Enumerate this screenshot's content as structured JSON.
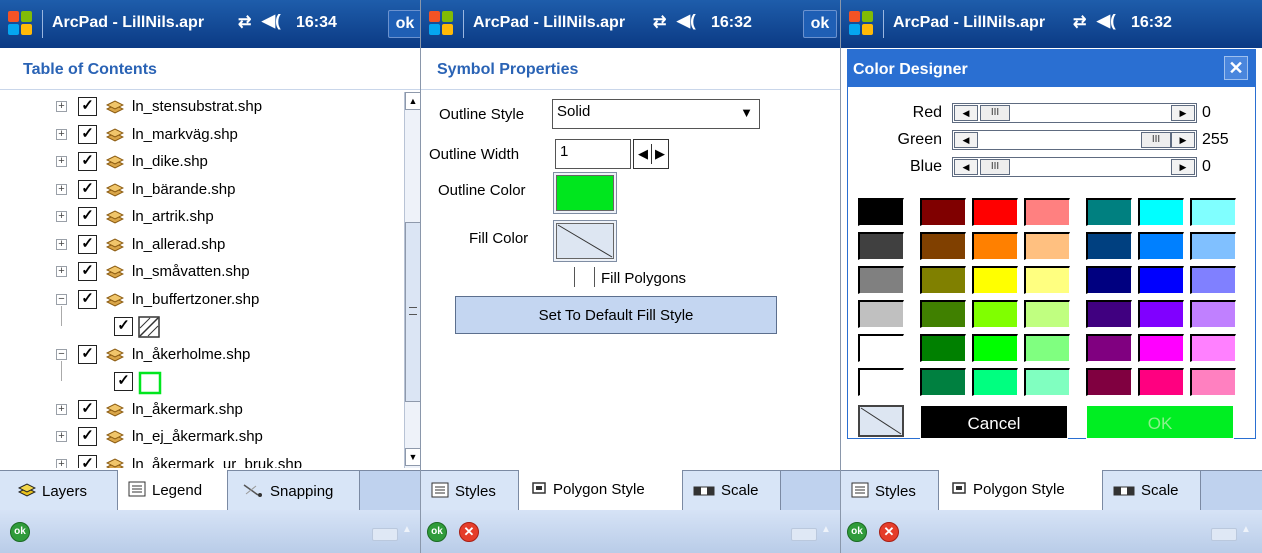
{
  "screens": [
    {
      "title": "ArcPad - LillNils.apr",
      "time": "16:34",
      "ok": "ok",
      "header": "Table of Contents",
      "layers": [
        {
          "name": "ln_stensubstrat.shp",
          "expanded": false
        },
        {
          "name": "ln_markväg.shp",
          "expanded": false
        },
        {
          "name": "ln_dike.shp",
          "expanded": false
        },
        {
          "name": "ln_bärande.shp",
          "expanded": false
        },
        {
          "name": "ln_artrik.shp",
          "expanded": false
        },
        {
          "name": "ln_allerad.shp",
          "expanded": false
        },
        {
          "name": "ln_småvatten.shp",
          "expanded": false
        },
        {
          "name": "ln_buffertzoner.shp",
          "expanded": true
        },
        {
          "name": "ln_åkerholme.shp",
          "expanded": true
        },
        {
          "name": "ln_åkermark.shp",
          "expanded": false
        },
        {
          "name": "ln_ej_åkermark.shp",
          "expanded": false
        },
        {
          "name": "ln_åkermark_ur_bruk.shp",
          "expanded": false
        }
      ],
      "tabs": [
        "Layers",
        "Legend",
        "Snapping"
      ]
    },
    {
      "title": "ArcPad - LillNils.apr",
      "time": "16:32",
      "ok": "ok",
      "header": "Symbol Properties",
      "outline_style_label": "Outline Style",
      "outline_style_value": "Solid",
      "outline_width_label": "Outline Width",
      "outline_width_value": "1",
      "outline_color_label": "Outline Color",
      "outline_color": "#00e61e",
      "fill_color_label": "Fill Color",
      "fill_polygons_label": "Fill Polygons",
      "default_button": "Set To Default Fill Style",
      "tabs": [
        "Styles",
        "Polygon Style",
        "Scale"
      ]
    },
    {
      "title": "ArcPad - LillNils.apr",
      "time": "16:32",
      "header": "Color Designer",
      "sliders": [
        {
          "label": "Red",
          "value": "0",
          "level": 0
        },
        {
          "label": "Green",
          "value": "255",
          "level": 1
        },
        {
          "label": "Blue",
          "value": "0",
          "level": 0
        }
      ],
      "palette": [
        [
          "#000000",
          "#800000",
          "#ff0000",
          "#ff8080",
          "#008080",
          "#00ffff",
          "#80ffff"
        ],
        [
          "#404040",
          "#804000",
          "#ff8000",
          "#ffc080",
          "#004080",
          "#0080ff",
          "#80c0ff"
        ],
        [
          "#808080",
          "#808000",
          "#ffff00",
          "#ffff80",
          "#000080",
          "#0000ff",
          "#8080ff"
        ],
        [
          "#c0c0c0",
          "#408000",
          "#80ff00",
          "#c0ff80",
          "#400080",
          "#8000ff",
          "#c080ff"
        ],
        [
          "#ffffff",
          "#008000",
          "#00ff00",
          "#80ff80",
          "#800080",
          "#ff00ff",
          "#ff80ff"
        ],
        [
          null,
          "#008040",
          "#00ff80",
          "#80ffc0",
          "#800040",
          "#ff0080",
          "#ff80c0"
        ]
      ],
      "cancel": "Cancel",
      "ok_button": "OK",
      "tabs": [
        "Styles",
        "Polygon Style",
        "Scale"
      ]
    }
  ]
}
